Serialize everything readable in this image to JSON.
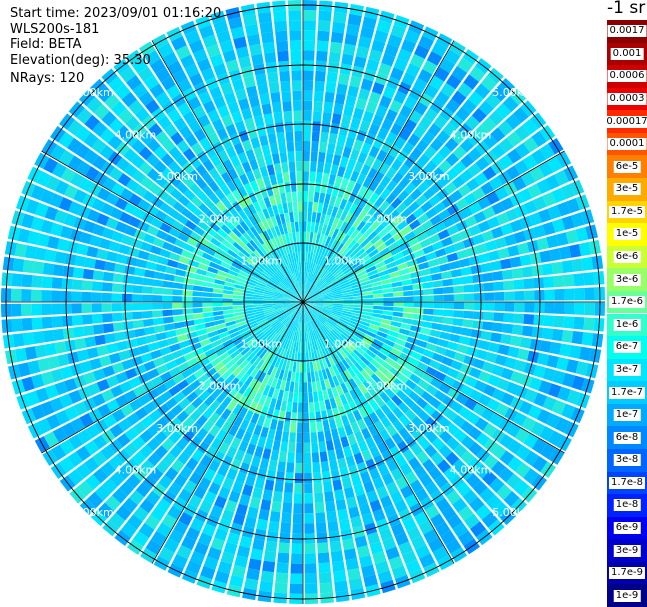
{
  "header": {
    "start_time": "Start time: 2023/09/01 01:16:20",
    "instrument": "WLS200s-181",
    "field": "Field: BETA",
    "elevation": "Elevation(deg): 35.30",
    "nrays": "NRays: 120"
  },
  "colorbar": {
    "unit_label": "-1 sr",
    "entries": [
      {
        "label": "0.0017",
        "color": "#8b0000"
      },
      {
        "label": "0.001",
        "color": "#aa0000"
      },
      {
        "label": "0.0006",
        "color": "#cc0000"
      },
      {
        "label": "0.0003",
        "color": "#ee0000"
      },
      {
        "label": "0.00017",
        "color": "#ff2a00"
      },
      {
        "label": "0.0001",
        "color": "#ff5500"
      },
      {
        "label": "6e-5",
        "color": "#ff8000"
      },
      {
        "label": "3e-5",
        "color": "#ffaa00"
      },
      {
        "label": "1.7e-5",
        "color": "#ffd400"
      },
      {
        "label": "1e-5",
        "color": "#ffff00"
      },
      {
        "label": "6e-6",
        "color": "#ccff33"
      },
      {
        "label": "3e-6",
        "color": "#99ff66"
      },
      {
        "label": "1.7e-6",
        "color": "#66ff99"
      },
      {
        "label": "1e-6",
        "color": "#33ffcc"
      },
      {
        "label": "6e-7",
        "color": "#00ffee"
      },
      {
        "label": "3e-7",
        "color": "#00e5ff"
      },
      {
        "label": "1.7e-7",
        "color": "#00ccff"
      },
      {
        "label": "1e-7",
        "color": "#00aaff"
      },
      {
        "label": "6e-8",
        "color": "#0088ff"
      },
      {
        "label": "3e-8",
        "color": "#0066ff"
      },
      {
        "label": "1.7e-8",
        "color": "#0044ff"
      },
      {
        "label": "1e-8",
        "color": "#0022ff"
      },
      {
        "label": "6e-9",
        "color": "#0000ee"
      },
      {
        "label": "3e-9",
        "color": "#0000cc"
      },
      {
        "label": "1.7e-9",
        "color": "#0000aa"
      },
      {
        "label": "1e-9",
        "color": "#000088"
      }
    ]
  },
  "ppi": {
    "range_ring_labels": [
      "1.00km",
      "2.00km",
      "3.00km",
      "4.00km",
      "5.00km"
    ],
    "ray_count": 120
  }
}
